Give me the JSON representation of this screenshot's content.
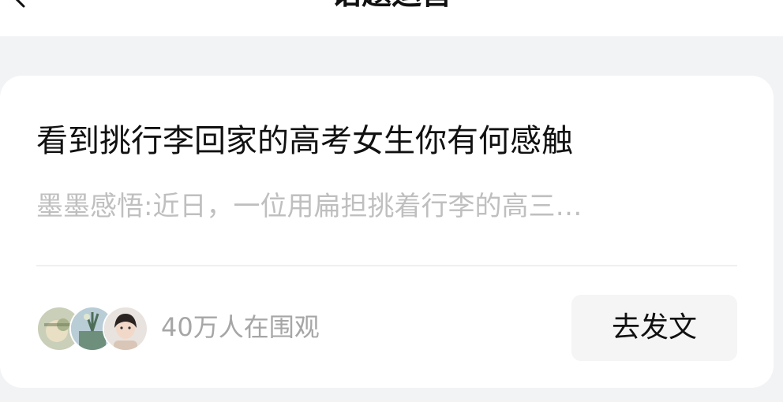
{
  "header": {
    "title": "话题运营",
    "back_icon": "chevron-left-icon"
  },
  "card": {
    "title": "看到挑行李回家的高考女生你有何感触",
    "description": "墨墨感悟:近日，一位用扁担挑着行李的高三…",
    "viewers": "40万人在围观",
    "post_button_label": "去发文",
    "avatars": [
      "avatar-1",
      "avatar-2",
      "avatar-3"
    ]
  }
}
